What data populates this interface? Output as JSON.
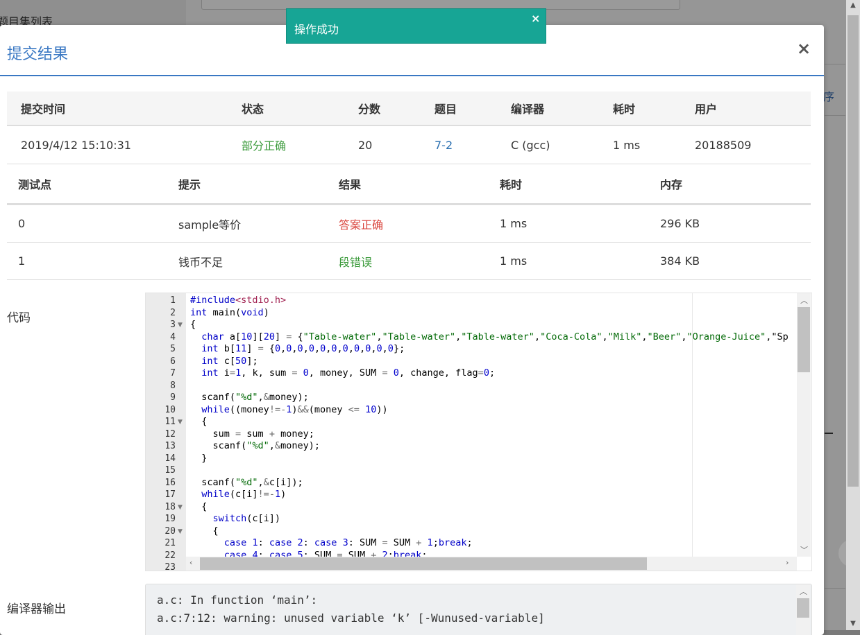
{
  "background": {
    "page_title": "题目集列表",
    "right_link": "序"
  },
  "toast": {
    "message": "操作成功",
    "close_label": "×",
    "color": "#17a595"
  },
  "modal": {
    "title": "提交结果",
    "close_label": "×",
    "accent_color": "#3a78c3"
  },
  "summary": {
    "headers": [
      "提交时间",
      "状态",
      "分数",
      "题目",
      "编译器",
      "耗时",
      "用户"
    ],
    "row": {
      "time": "2019/4/12 15:10:31",
      "status": "部分正确",
      "score": "20",
      "problem": "7-2",
      "compiler": "C (gcc)",
      "elapsed": "1 ms",
      "user": "20188509"
    }
  },
  "cases": {
    "headers": [
      "测试点",
      "提示",
      "结果",
      "耗时",
      "内存"
    ],
    "rows": [
      {
        "id": "0",
        "hint": "sample等价",
        "result": "答案正确",
        "time": "1 ms",
        "memory": "296 KB"
      },
      {
        "id": "1",
        "hint": "钱币不足",
        "result": "段错误",
        "time": "1 ms",
        "memory": "384 KB"
      }
    ]
  },
  "code_section": {
    "label": "代码",
    "line_numbers": [
      "1",
      "2",
      "3",
      "4",
      "5",
      "6",
      "7",
      "8",
      "9",
      "10",
      "11",
      "12",
      "13",
      "14",
      "15",
      "16",
      "17",
      "18",
      "19",
      "20",
      "21",
      "22",
      "23"
    ],
    "lines": [
      "#include<stdio.h>",
      "int main(void)",
      "{",
      "  char a[10][20] = {\"Table-water\",\"Table-water\",\"Table-water\",\"Coca-Cola\",\"Milk\",\"Beer\",\"Orange-Juice\",\"Sp",
      "  int b[11] = {0,0,0,0,0,0,0,0,0,0,0};",
      "  int c[50];",
      "  int i=1, k, sum = 0, money, SUM = 0, change, flag=0;",
      "",
      "  scanf(\"%d\",&money);",
      "  while((money!=-1)&&(money <= 10))",
      "  {",
      "    sum = sum + money;",
      "    scanf(\"%d\",&money);",
      "  }",
      "",
      "  scanf(\"%d\",&c[i]);",
      "  while(c[i]!=-1)",
      "  {",
      "    switch(c[i])",
      "    {",
      "      case 1: case 2: case 3: SUM = SUM + 1;break;",
      "      case 4: case 5: SUM = SUM + 2;break;",
      ""
    ]
  },
  "compiler_output": {
    "label": "编译器输出",
    "lines": [
      "a.c: In function ‘main’:",
      "a.c:7:12: warning: unused variable ‘k’ [-Wunused-variable]"
    ]
  }
}
